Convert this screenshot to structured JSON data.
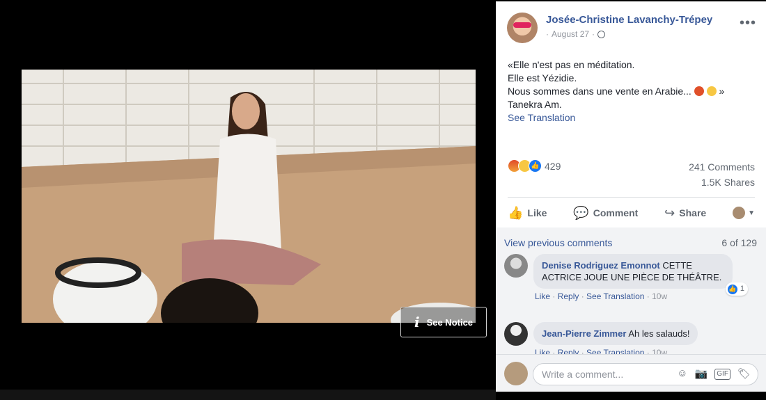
{
  "photo": {
    "notice_label": "See Notice"
  },
  "post": {
    "author": "Josée-Christine Lavanchy-Trépey",
    "date": "August 27",
    "date_sep": "·",
    "text_lines": [
      "«Elle n'est pas en méditation.",
      "Elle est Yézidie.",
      "Nous sommes dans une vente en Arabie...",
      "Tanekra Am."
    ],
    "line3_suffix": "»",
    "see_translation": "See Translation"
  },
  "stats": {
    "reaction_count": "429",
    "comments": "241 Comments",
    "shares": "1.5K Shares"
  },
  "actions": {
    "like": "Like",
    "comment": "Comment",
    "share": "Share"
  },
  "comments": {
    "view_previous": "View previous comments",
    "pager": "6 of 129",
    "items": [
      {
        "name": "Denise Rodriguez Emonnot",
        "text": "CETTE ACTRICE JOUE UNE PIÈCE DE THÉÂTRE.",
        "like": "Like",
        "reply": "Reply",
        "see_translation": "See Translation",
        "time": "10w",
        "likes": "1"
      },
      {
        "name": "Jean-Pierre Zimmer",
        "text": "Ah les salauds!",
        "like": "Like",
        "reply": "Reply",
        "see_translation": "See Translation",
        "time": "10w"
      }
    ]
  },
  "composer": {
    "placeholder": "Write a comment..."
  },
  "colors": {
    "link": "#385898",
    "muted": "#90949c",
    "like_blue": "#1877f2"
  },
  "icons": [
    "info-icon",
    "globe-icon",
    "more-icon",
    "like-icon",
    "comment-icon",
    "share-icon",
    "emoji-icon",
    "camera-icon",
    "gif-icon",
    "sticker-icon"
  ]
}
